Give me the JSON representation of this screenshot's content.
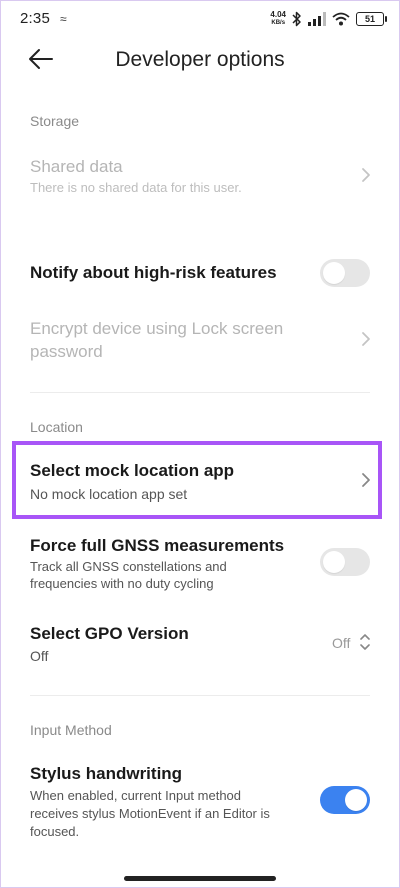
{
  "status_bar": {
    "time": "2:35",
    "left_icon": "≈",
    "net_speed_value": "4.04",
    "net_speed_unit": "KB/s",
    "battery": "51"
  },
  "header": {
    "title": "Developer options"
  },
  "storage": {
    "section_label": "Storage",
    "shared_data_title": "Shared data",
    "shared_data_subtitle": "There is no shared data for this user."
  },
  "notify": {
    "title": "Notify about high-risk features",
    "enabled": false
  },
  "encrypt": {
    "title_line1": "Encrypt device using Lock screen",
    "title_line2": "password"
  },
  "location": {
    "section_label": "Location",
    "mock_title": "Select mock location app",
    "mock_subtitle": "No mock location app set",
    "gnss_title": "Force full GNSS measurements",
    "gnss_subtitle_line1": "Track all GNSS constellations and",
    "gnss_subtitle_line2": "frequencies with no duty cycling",
    "gnss_enabled": false,
    "gpo_title": "Select GPO Version",
    "gpo_subtitle": "Off",
    "gpo_value": "Off"
  },
  "input_method": {
    "section_label": "Input Method",
    "stylus_title": "Stylus handwriting",
    "stylus_subtitle_line1": "When enabled, current Input method",
    "stylus_subtitle_line2": "receives stylus MotionEvent if an Editor is",
    "stylus_subtitle_line3": "focused.",
    "stylus_enabled": true
  },
  "colors": {
    "highlight": "#a855f7",
    "toggle_on": "#3b82f0",
    "toggle_off": "#e6e6e6"
  },
  "icons": [
    "back-arrow-icon",
    "chevron-right-icon",
    "bluetooth-icon",
    "signal-icon",
    "wifi-icon",
    "battery-icon",
    "updown-chevron-icon"
  ]
}
